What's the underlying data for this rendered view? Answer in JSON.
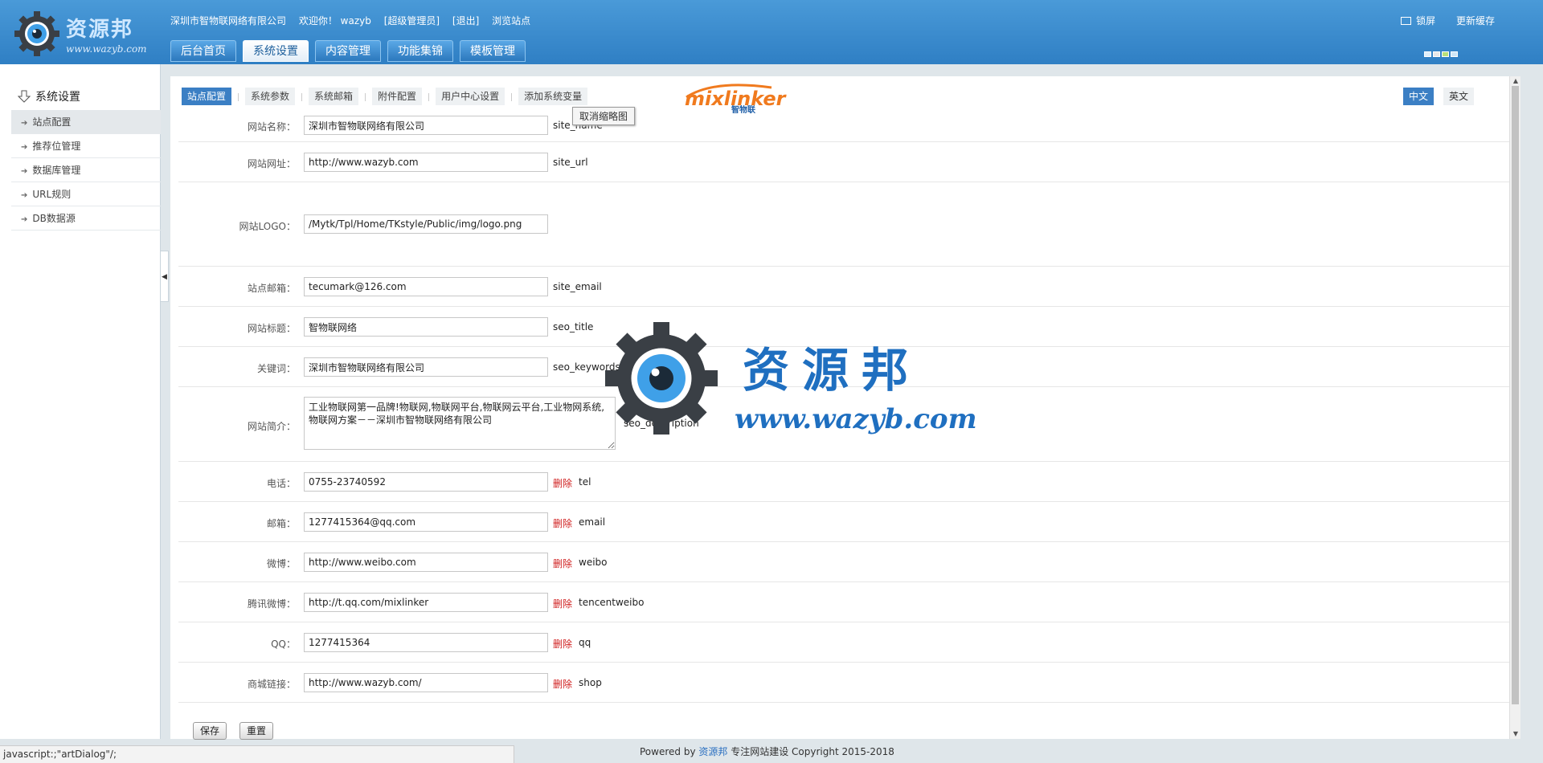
{
  "header": {
    "logo_text": "资源邦",
    "logo_url": "www.wazyb.com",
    "company": "深圳市智物联网络有限公司",
    "welcome": "欢迎你！ wazyb",
    "role": "[超级管理员]",
    "logout": "[退出]",
    "browse": "浏览站点",
    "lock": "锁屏",
    "refresh_cache": "更新缓存",
    "nav": [
      {
        "label": "后台首页"
      },
      {
        "label": "系统设置"
      },
      {
        "label": "内容管理"
      },
      {
        "label": "功能集锦"
      },
      {
        "label": "模板管理"
      }
    ]
  },
  "sidebar": {
    "title": "系统设置",
    "items": [
      {
        "label": "站点配置"
      },
      {
        "label": "推荐位管理"
      },
      {
        "label": "数据库管理"
      },
      {
        "label": "URL规则"
      },
      {
        "label": "DB数据源"
      }
    ]
  },
  "main": {
    "subtabs": [
      {
        "label": "站点配置"
      },
      {
        "label": "系统参数"
      },
      {
        "label": "系统邮箱"
      },
      {
        "label": "附件配置"
      },
      {
        "label": "用户中心设置"
      },
      {
        "label": "添加系统变量"
      }
    ],
    "tooltip": "取消缩略图",
    "brand_name": "mixlinker",
    "brand_sub": "智物联",
    "lang": {
      "cn": "中文",
      "en": "英文"
    },
    "delete_label": "删除",
    "fields": {
      "site_name": {
        "label": "网站名称：",
        "value": "深圳市智物联网络有限公司",
        "key": "site_name"
      },
      "site_url": {
        "label": "网站网址：",
        "value": "http://www.wazyb.com",
        "key": "site_url"
      },
      "logo": {
        "label": "网站LOGO：",
        "value": "/Mytk/Tpl/Home/TKstyle/Public/img/logo.png"
      },
      "site_email": {
        "label": "站点邮箱：",
        "value": "tecumark@126.com",
        "key": "site_email"
      },
      "seo_title": {
        "label": "网站标题：",
        "value": "智物联网络",
        "key": "seo_title"
      },
      "seo_keywords": {
        "label": "关键词：",
        "value": "深圳市智物联网络有限公司",
        "key": "seo_keywords"
      },
      "seo_description": {
        "label": "网站简介：",
        "value": "工业物联网第一品牌!物联网,物联网平台,物联网云平台,工业物网系统,物联网方案－－深圳市智物联网络有限公司",
        "key": "seo_description"
      },
      "tel": {
        "label": "电话：",
        "value": "0755-23740592",
        "key": "tel"
      },
      "email": {
        "label": "邮箱：",
        "value": "1277415364@qq.com",
        "key": "email"
      },
      "weibo": {
        "label": "微博：",
        "value": "http://www.weibo.com",
        "key": "weibo"
      },
      "tencentweibo": {
        "label": "腾讯微博：",
        "value": "http://t.qq.com/mixlinker",
        "key": "tencentweibo"
      },
      "qq": {
        "label": "QQ：",
        "value": "1277415364",
        "key": "qq"
      },
      "shop": {
        "label": "商城链接：",
        "value": "http://www.wazyb.com/",
        "key": "shop"
      }
    },
    "buttons": {
      "save": "保存",
      "reset": "重置"
    }
  },
  "watermark": {
    "text": "资源邦",
    "url": "www.wazyb.com"
  },
  "footer": {
    "powered": "Powered by",
    "link": "资源邦",
    "rest": "专注网站建设  Copyright 2015-2018"
  },
  "statusbar": "javascript:;\"artDialog\"/;",
  "colors": {
    "header_blue": "#2f7fc4",
    "active_tab": "#3b7fc4",
    "delete_red": "#d02020",
    "brand_orange": "#f07a1e",
    "brand_blue": "#1f5fa8"
  }
}
